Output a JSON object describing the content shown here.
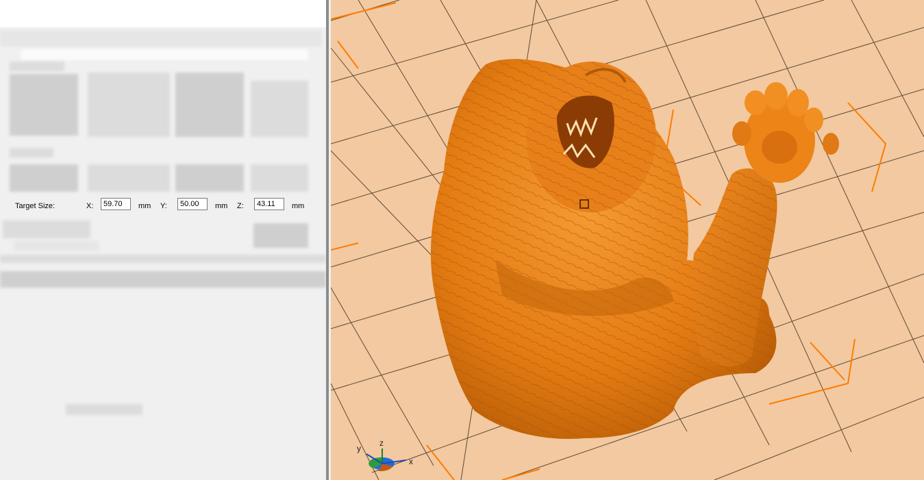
{
  "target_size": {
    "label": "Target Size:",
    "x_label": "X:",
    "x_value": "59.70",
    "y_label": "Y:",
    "y_value": "50.00",
    "z_label": "Z:",
    "z_value": "43.11",
    "unit": "mm"
  },
  "axis_gizmo": {
    "x": "x",
    "y": "y",
    "z": "z"
  },
  "colors": {
    "model": "#e37b12",
    "bed": "#f2c9a0",
    "grid": "#3a2a1c",
    "bed_marker": "#ff7b00"
  },
  "icons": {
    "selection_handle": "square-handle-icon"
  }
}
